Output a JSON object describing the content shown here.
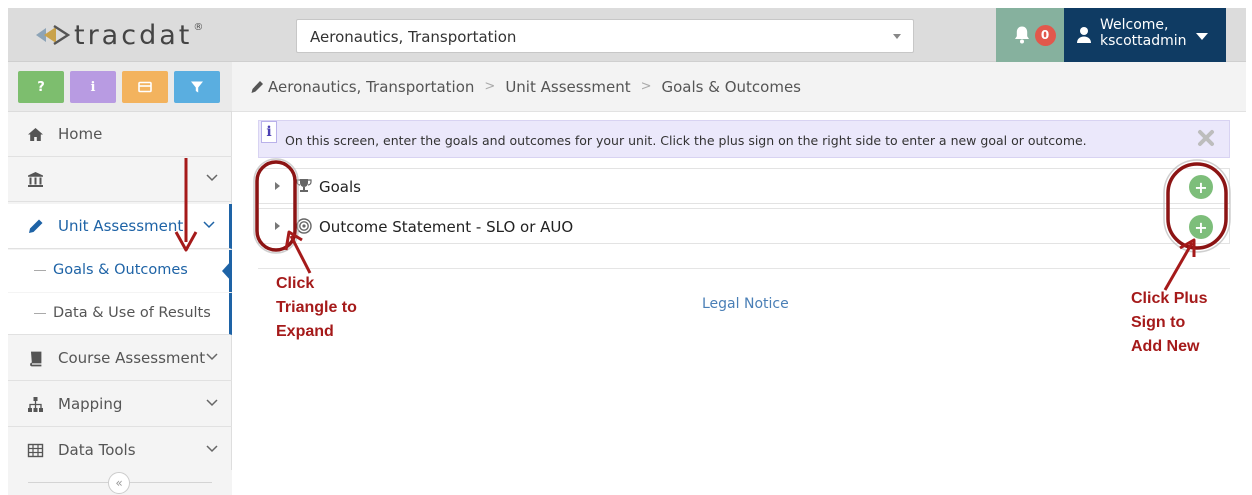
{
  "header": {
    "logo_text": "tracdat",
    "logo_mark": "®",
    "unit_selector": {
      "value": "Aeronautics, Transportation"
    },
    "notifications": {
      "icon": "bell-icon",
      "count": "0"
    },
    "user": {
      "line1": "Welcome,",
      "line2": "kscottadmin",
      "icon": "user-icon"
    }
  },
  "toolbar": {
    "buttons": [
      {
        "label": "?",
        "color": "#7dbe6e",
        "icon": "help-icon"
      },
      {
        "label": "i",
        "color": "#b89be2",
        "icon": "info-icon"
      },
      {
        "label": "",
        "color": "#f3b35e",
        "icon": "card-icon"
      },
      {
        "label": "",
        "color": "#5aaee0",
        "icon": "filter-icon"
      }
    ]
  },
  "sidebar": {
    "items": [
      {
        "label": "Home",
        "icon": "home-icon"
      },
      {
        "label": "",
        "icon": "institution-icon"
      },
      {
        "label": "Unit Assessment",
        "icon": "pencil-icon"
      },
      {
        "label": "Course Assessment",
        "icon": "book-icon"
      },
      {
        "label": "Mapping",
        "icon": "sitemap-icon"
      },
      {
        "label": "Data Tools",
        "icon": "table-icon"
      }
    ],
    "subitems": [
      {
        "label": "Goals & Outcomes"
      },
      {
        "label": "Data & Use of Results"
      }
    ],
    "collapse_label": "«"
  },
  "breadcrumb": {
    "items": [
      "Aeronautics, Transportation",
      "Unit Assessment",
      "Goals & Outcomes"
    ],
    "separator": ">"
  },
  "info": {
    "icon_label": "i",
    "text": "On this screen, enter the goals and outcomes for your unit. Click the plus sign on the right side to enter a new goal or outcome."
  },
  "sections": [
    {
      "label": "Goals",
      "icon": "trophy-icon"
    },
    {
      "label": "Outcome Statement - SLO or AUO",
      "icon": "target-icon"
    }
  ],
  "add_label": "+",
  "footer": {
    "legal": "Legal Notice"
  },
  "annotations": {
    "left": [
      "Click",
      "Triangle to",
      "Expand"
    ],
    "right": [
      "Click Plus",
      "Sign to",
      "Add New"
    ],
    "color": "#a51a1a"
  },
  "colors": {
    "header_bg": "#dcdcdc",
    "notif_bg": "#86b19e",
    "user_bg": "#0f3b63",
    "accent": "#1e63a6",
    "info_bg": "#ebe8fb",
    "add_green": "#7dbe7a"
  }
}
